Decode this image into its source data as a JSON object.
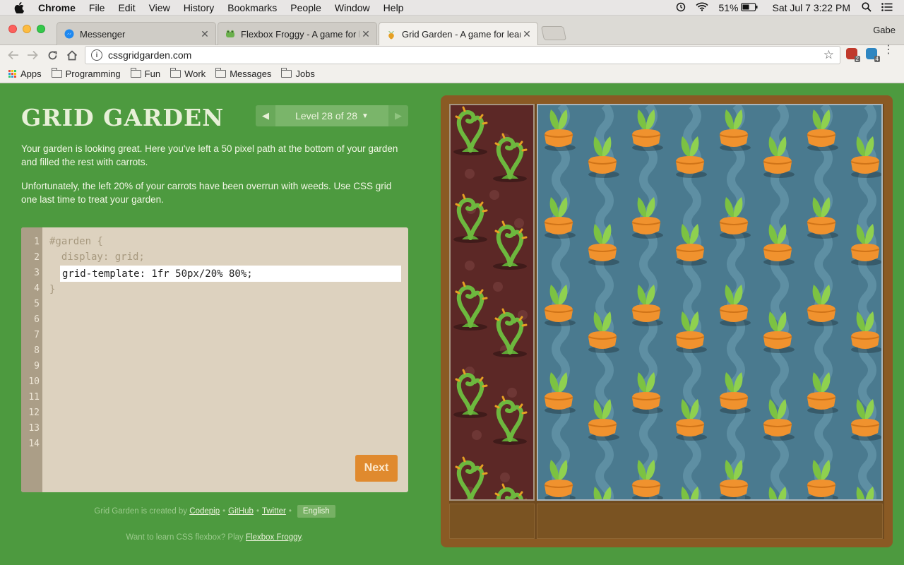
{
  "menubar": {
    "app": "Chrome",
    "items": [
      "File",
      "Edit",
      "View",
      "History",
      "Bookmarks",
      "People",
      "Window",
      "Help"
    ],
    "battery": "51%",
    "clock": "Sat Jul 7  3:22 PM"
  },
  "tabs": [
    {
      "title": "Messenger",
      "favicon": "messenger-icon",
      "active": false
    },
    {
      "title": "Flexbox Froggy - A game for le",
      "favicon": "frog-icon",
      "active": false
    },
    {
      "title": "Grid Garden - A game for learn",
      "favicon": "carrot-icon",
      "active": true
    }
  ],
  "profile": "Gabe",
  "url": "cssgridgarden.com",
  "extensions": [
    {
      "name": "red-extension-icon",
      "badge": "2",
      "color": "#c0392b"
    },
    {
      "name": "blue-extension-icon",
      "badge": "4",
      "color": "#2e86c1"
    }
  ],
  "bookmarks": {
    "apps": "Apps",
    "folders": [
      "Programming",
      "Fun",
      "Work",
      "Messages",
      "Jobs"
    ]
  },
  "game": {
    "title": "GRID GARDEN",
    "level_label": "Level 28 of 28",
    "instructions": [
      "Your garden is looking great. Here you've left a 50 pixel path at the bottom of your garden and filled the rest with carrots.",
      "Unfortunately, the left 20% of your carrots have been overrun with weeds. Use CSS grid one last time to treat your garden."
    ],
    "line_numbers": [
      "1",
      "2",
      "3",
      "4",
      "5",
      "6",
      "7",
      "8",
      "9",
      "10",
      "11",
      "12",
      "13",
      "14"
    ],
    "code_lines": [
      "#garden {",
      "  display: grid;",
      "}"
    ],
    "input_value": "grid-template: 1fr 50px/20% 80%;",
    "next_label": "Next"
  },
  "footer": {
    "created_prefix": "Grid Garden is created by",
    "links": [
      "Codepip",
      "GitHub",
      "Twitter"
    ],
    "language": "English",
    "flexbox_prefix": "Want to learn CSS flexbox? Play",
    "flexbox_link": "Flexbox Froggy",
    "flexbox_suffix": "."
  },
  "colors": {
    "page_bg": "#4d9a3f",
    "next_button": "#e08a2e",
    "weed_soil": "#5c2826",
    "water": "#4a7a8f",
    "carrot": "#f0922e",
    "leaf": "#7cc242"
  }
}
